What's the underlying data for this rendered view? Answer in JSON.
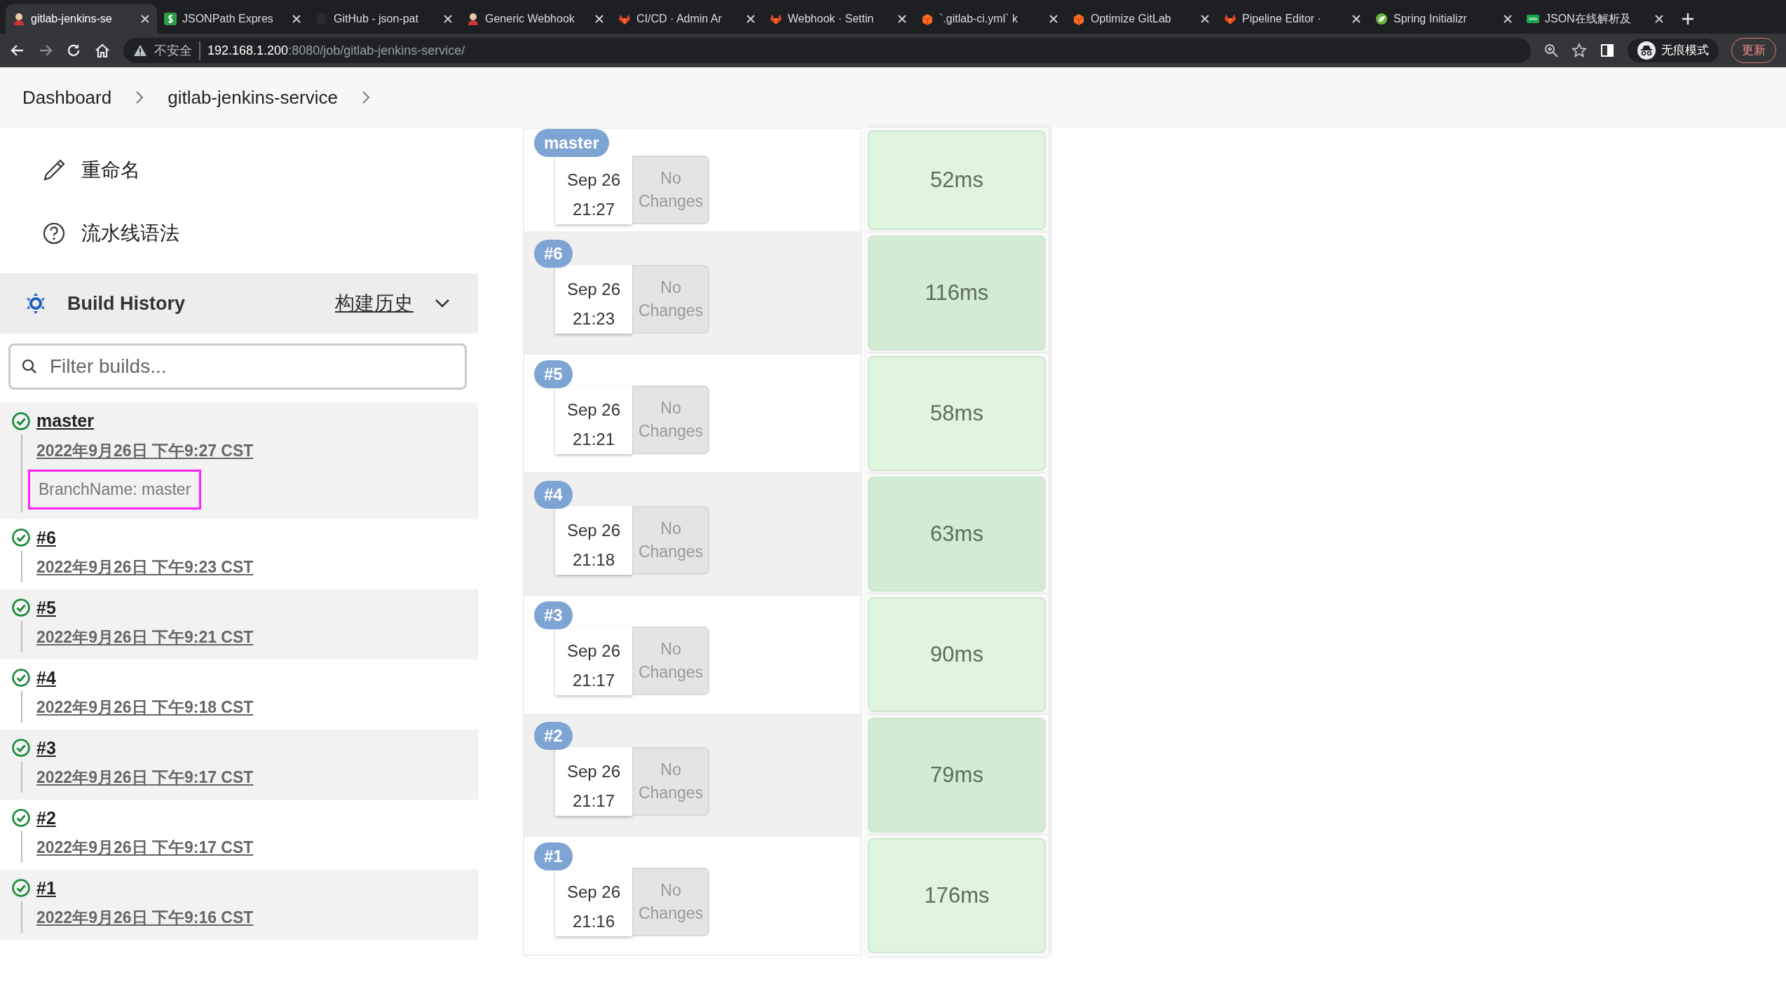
{
  "browser": {
    "tabs": [
      {
        "title": "gitlab-jenkins-se",
        "kind": "jenkins",
        "selected": true
      },
      {
        "title": "JSONPath Expres",
        "kind": "dollar",
        "selected": false
      },
      {
        "title": "GitHub - json-pat",
        "kind": "github",
        "selected": false
      },
      {
        "title": "Generic Webhook",
        "kind": "jenkins",
        "selected": false
      },
      {
        "title": "CI/CD · Admin Ar",
        "kind": "gitlab",
        "selected": false
      },
      {
        "title": "Webhook · Settin",
        "kind": "gitlab",
        "selected": false
      },
      {
        "title": "`.gitlab-ci.yml` k",
        "kind": "box",
        "selected": false
      },
      {
        "title": "Optimize GitLab",
        "kind": "box",
        "selected": false
      },
      {
        "title": "Pipeline Editor ·",
        "kind": "gitlab",
        "selected": false
      },
      {
        "title": "Spring Initializr",
        "kind": "spring",
        "selected": false
      },
      {
        "title": "JSON在线解析及",
        "kind": "json",
        "selected": false
      }
    ],
    "address": {
      "warning": "不安全",
      "host": "192.168.1.200",
      "path": ":8080/job/gitlab-jenkins-service/"
    },
    "profile": "无痕模式",
    "update": "更新"
  },
  "breadcrumb": [
    "Dashboard",
    "gitlab-jenkins-service"
  ],
  "sidebar": {
    "menu": [
      {
        "kind": "rename",
        "label": "重命名"
      },
      {
        "kind": "help",
        "label": "流水线语法"
      }
    ],
    "build_history": {
      "title": "Build History",
      "trend": "构建历史",
      "filter": {
        "placeholder": "Filter builds..."
      },
      "builds": [
        {
          "name": "master",
          "time": "2022年9月26日 下午9:27 CST",
          "description": "BranchName: master",
          "highlighted": true,
          "succeeded": true
        },
        {
          "name": "#6",
          "time": "2022年9月26日 下午9:23 CST",
          "succeeded": true
        },
        {
          "name": "#5",
          "time": "2022年9月26日 下午9:21 CST",
          "succeeded": true
        },
        {
          "name": "#4",
          "time": "2022年9月26日 下午9:18 CST",
          "succeeded": true
        },
        {
          "name": "#3",
          "time": "2022年9月26日 下午9:17 CST",
          "succeeded": true
        },
        {
          "name": "#2",
          "time": "2022年9月26日 下午9:17 CST",
          "succeeded": true
        },
        {
          "name": "#1",
          "time": "2022年9月26日 下午9:16 CST",
          "succeeded": true
        }
      ]
    }
  },
  "stage_view": {
    "rows": [
      {
        "badge": "master",
        "date": "Sep 26",
        "time": "21:27",
        "changes": "No Changes",
        "duration": "52ms"
      },
      {
        "badge": "#6",
        "date": "Sep 26",
        "time": "21:23",
        "changes": "No Changes",
        "duration": "116ms"
      },
      {
        "badge": "#5",
        "date": "Sep 26",
        "time": "21:21",
        "changes": "No Changes",
        "duration": "58ms"
      },
      {
        "badge": "#4",
        "date": "Sep 26",
        "time": "21:18",
        "changes": "No Changes",
        "duration": "63ms"
      },
      {
        "badge": "#3",
        "date": "Sep 26",
        "time": "21:17",
        "changes": "No Changes",
        "duration": "90ms"
      },
      {
        "badge": "#2",
        "date": "Sep 26",
        "time": "21:17",
        "changes": "No Changes",
        "duration": "79ms"
      },
      {
        "badge": "#1",
        "date": "Sep 26",
        "time": "21:16",
        "changes": "No Changes",
        "duration": "176ms"
      }
    ]
  }
}
